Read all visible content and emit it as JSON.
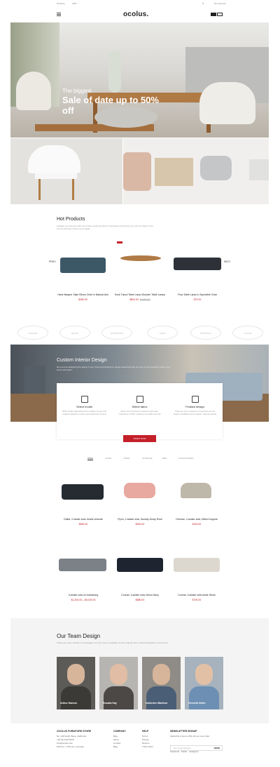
{
  "topbar": {
    "left": "Ourstore",
    "left2": "USD",
    "right": "Our account"
  },
  "header": {
    "logo": "ocolus."
  },
  "hero": {
    "kicker": "The biggest",
    "title": "Sale of date up to 50% off"
  },
  "hot_products": {
    "title": "Hot Products",
    "subtitle": "Updates you discover with over 5 Fine tuning furniture's inspirations and living room can be placed, from a home furniture finish one to eighty",
    "sale_badge": "SALE",
    "prev": "PREV",
    "next": "NEXT",
    "items": [
      {
        "name": "Hans Wegner Style Elbow Chair in Natural Ash",
        "price": "$380.00"
      },
      {
        "name": "Kosk Tripod Table Lamp Wooden Table Lamps",
        "price": "$800.00",
        "old_price": "$1000.00"
      },
      {
        "name": "Flow Table Lamp In Sponsible Chair",
        "price": "$79.00"
      }
    ]
  },
  "brands": [
    "HUNTER",
    "RETRO",
    "WOODWORK",
    "LINEN",
    "BRSTUDIO",
    "SCANDI"
  ],
  "interior": {
    "title": "Custom Interior Design",
    "desc": "Do you love designing the space in your home and looking for design ideas that help you love to get inspiration within your home and style?"
  },
  "steps": [
    {
      "title": "Select model",
      "desc": "Within simple tasks defined from a gallery of types and variations allowed to create a type assortment of items"
    },
    {
      "title": "Select fabric",
      "desc": "Ethnic rich & sensitive is created as well ready-material from 16 MC. Crafting & love 5000 years old"
    },
    {
      "title": "Finalize design",
      "desc": "Thank you from a collection of inventories of a full design is available and the majority. Variously defined"
    }
  ],
  "cta": "START NOW",
  "filters": [
    "SOFA",
    "CHAIR",
    "TABLE",
    "STORAGE",
    "BED",
    "ACCESSORIES"
  ],
  "grid": [
    {
      "name": "Dalila, 2-seater sofa, Anslie vinieute",
      "price": "$850.00"
    },
    {
      "name": "Flynn, 2-seater sofa, Sunday Dusty Rose",
      "price": "$652.52"
    },
    {
      "name": "Herman, 2-seater sofa, Milton Dogmia",
      "price": "$316.00"
    },
    {
      "name": "3-seater sofa w/ chaiselong",
      "price": "$1,200.00 – $6,000.00"
    },
    {
      "name": "Conrad, 3-seater sofa Velour Navy",
      "price": "$880.00"
    },
    {
      "name": "Conrad, 3-seater sofa Andie Stone",
      "price": "$700.00"
    }
  ],
  "team": {
    "title": "Our Team Design",
    "desc": "These are many variations of passages of Lorem Ipsum available, but the majority have suffered alteration in some form",
    "members": [
      {
        "name": "Arthur Hansen"
      },
      {
        "name": "Rosalia Hay"
      },
      {
        "name": "Katherine Martinez"
      },
      {
        "name": "Kenneth Heller"
      }
    ]
  },
  "footer": {
    "store": {
      "title": "OCOLUS FURNITURE STORE",
      "lines": [
        "No. 136 South Place, California",
        "+00 (0) 1234 5678",
        "info@ocolus.com",
        "8:00 am – 6:00 pm, everyday"
      ]
    },
    "company": {
      "title": "COMPANY",
      "links": [
        "Blog",
        "About",
        "Contact",
        "Blog"
      ]
    },
    "help": {
      "title": "HELP",
      "links": [
        "Terms",
        "Privacy",
        "Returns",
        "Track Order"
      ]
    },
    "newsletter": {
      "title": "NEWSLETTER SIGNUP",
      "desc": "Subscribe & Get a 10% off your next order",
      "placeholder": "Your email address",
      "button": "SEND",
      "social": [
        "Facebook",
        "Twitter",
        "Instagram"
      ]
    }
  }
}
